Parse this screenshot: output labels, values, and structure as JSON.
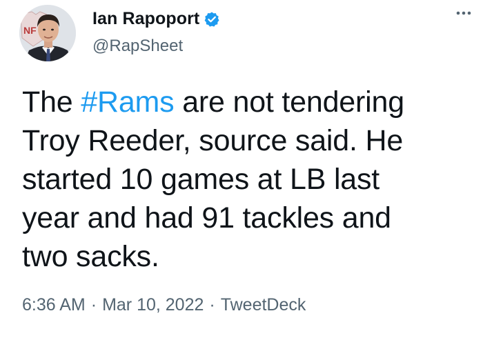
{
  "author": {
    "display_name": "Ian Rapoport",
    "handle": "@RapSheet",
    "verified": true,
    "avatar_icon": "profile-photo"
  },
  "tweet": {
    "line1_prefix": "The ",
    "hashtag": "#Rams",
    "line1_suffix": " are not tendering",
    "line2": "Troy Reeder, source said. He",
    "line3": "started 10 games at LB last",
    "line4": "year and had 91 tackles and",
    "line5": "two sacks."
  },
  "meta": {
    "time": "6:36 AM",
    "separator": "·",
    "date": "Mar 10, 2022",
    "source": "TweetDeck"
  },
  "colors": {
    "verified_blue": "#1d9bf0",
    "hashtag_blue": "#1d9bf0",
    "secondary_text": "#536471"
  }
}
